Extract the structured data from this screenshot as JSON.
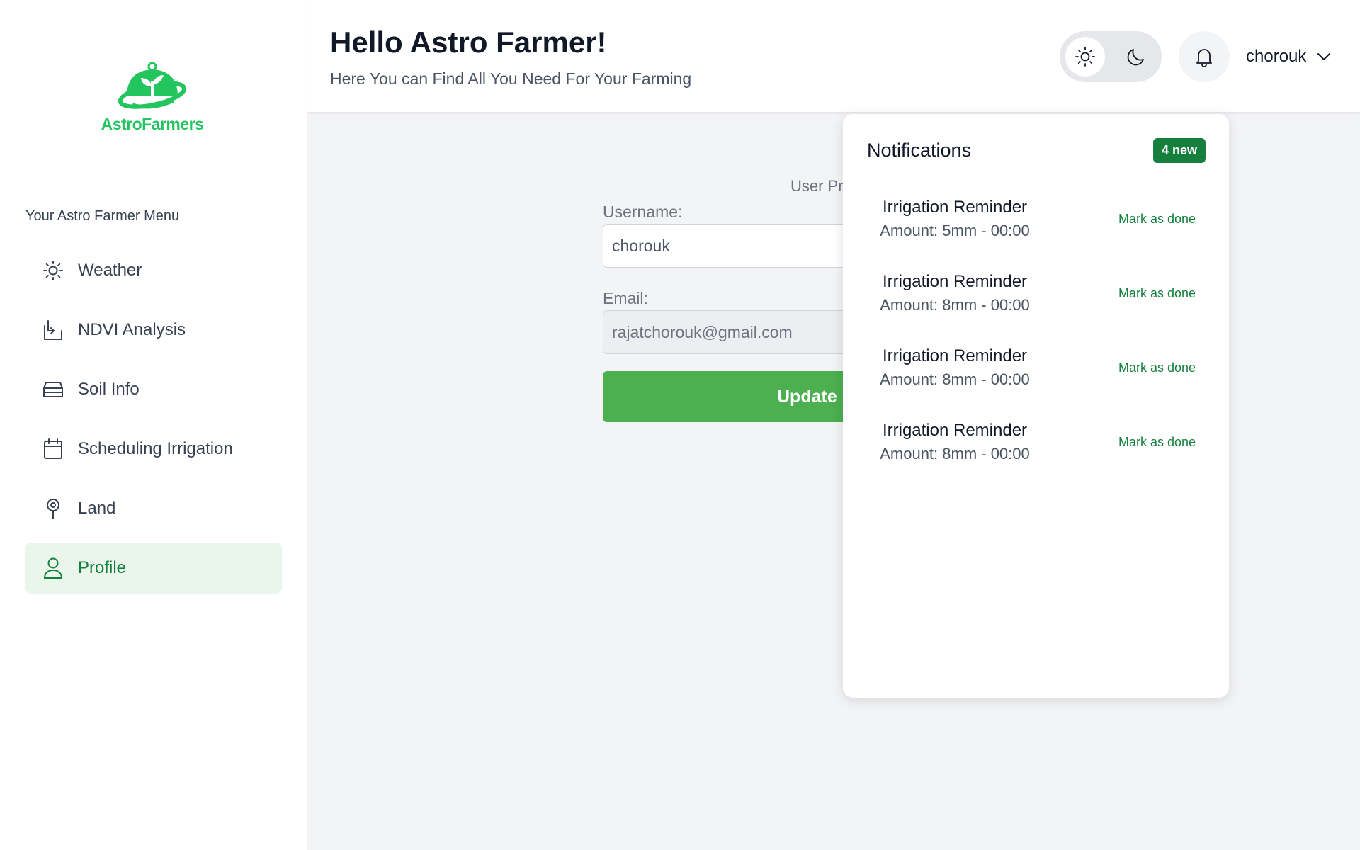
{
  "app": {
    "name": "AstroFarmers"
  },
  "sidebar": {
    "menu_title": "Your Astro Farmer Menu",
    "items": [
      {
        "label": "Weather",
        "icon": "sun-icon"
      },
      {
        "label": "NDVI Analysis",
        "icon": "ndvi-icon"
      },
      {
        "label": "Soil Info",
        "icon": "soil-icon"
      },
      {
        "label": "Scheduling Irrigation",
        "icon": "calendar-icon"
      },
      {
        "label": "Land",
        "icon": "map-pin-icon"
      },
      {
        "label": "Profile",
        "icon": "user-icon",
        "active": true
      }
    ]
  },
  "header": {
    "greeting": "Hello Astro Farmer!",
    "subtitle": "Here You can Find All You Need For Your Farming",
    "username": "chorouk"
  },
  "profile_form": {
    "title": "User Pr",
    "username_label": "Username:",
    "username_value": "chorouk",
    "email_label": "Email:",
    "email_value": "rajatchorouk@gmail.com",
    "update_button": "Update I"
  },
  "notifications": {
    "title": "Notifications",
    "badge": "4 new",
    "items": [
      {
        "title": "Irrigation Reminder",
        "amount": "Amount: 5mm - 00:00",
        "action": "Mark as done"
      },
      {
        "title": "Irrigation Reminder",
        "amount": "Amount: 8mm - 00:00",
        "action": "Mark as done"
      },
      {
        "title": "Irrigation Reminder",
        "amount": "Amount: 8mm - 00:00",
        "action": "Mark as done"
      },
      {
        "title": "Irrigation Reminder",
        "amount": "Amount: 8mm - 00:00",
        "action": "Mark as done"
      }
    ]
  },
  "colors": {
    "brand_green": "#22c55e",
    "accent_green": "#15803d",
    "button_green": "#4caf50",
    "active_bg": "#eaf6ec"
  }
}
